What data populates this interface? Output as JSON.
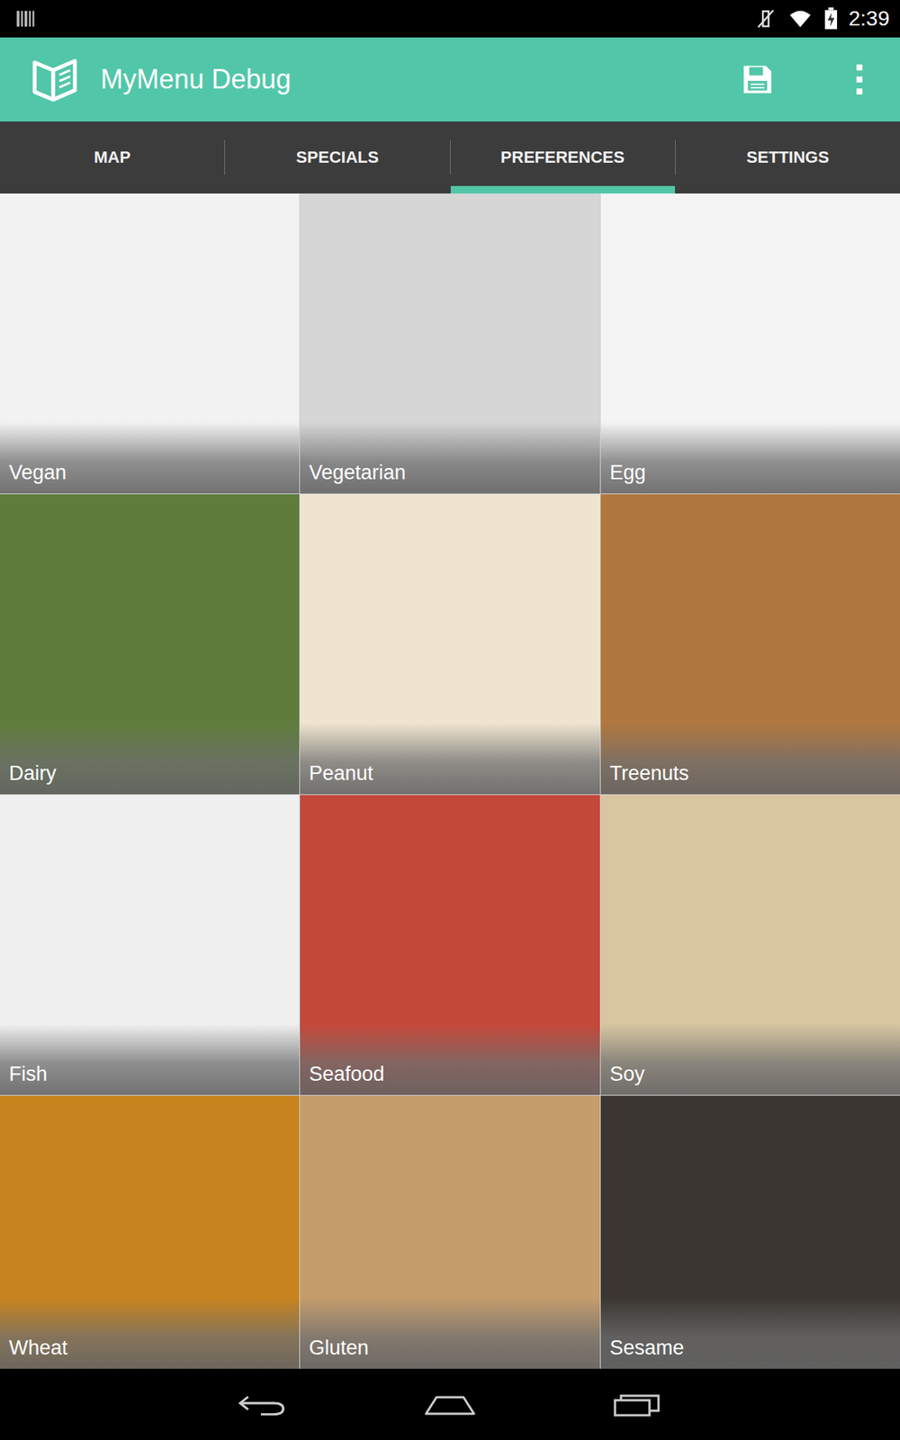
{
  "status_bar": {
    "time": "2:39",
    "wifi": true,
    "muted": true,
    "battery_charging": true
  },
  "app_bar": {
    "title": "MyMenu Debug"
  },
  "tabs": [
    {
      "label": "MAP",
      "selected": false
    },
    {
      "label": "SPECIALS",
      "selected": false
    },
    {
      "label": "PREFERENCES",
      "selected": true
    },
    {
      "label": "SETTINGS",
      "selected": false
    }
  ],
  "preferences": [
    {
      "label": "Vegan",
      "color": "#f2f2f2"
    },
    {
      "label": "Vegetarian",
      "color": "#d6d6d6"
    },
    {
      "label": "Egg",
      "color": "#f4f4f4"
    },
    {
      "label": "Dairy",
      "color": "#5f7c3c"
    },
    {
      "label": "Peanut",
      "color": "#efe4cf"
    },
    {
      "label": "Treenuts",
      "color": "#b0773f"
    },
    {
      "label": "Fish",
      "color": "#f0f0f0"
    },
    {
      "label": "Seafood",
      "color": "#c4493a"
    },
    {
      "label": "Soy",
      "color": "#d8c6a0"
    },
    {
      "label": "Wheat",
      "color": "#c8841e"
    },
    {
      "label": "Gluten",
      "color": "#c59c6c"
    },
    {
      "label": "Sesame",
      "color": "#3b3631"
    }
  ]
}
